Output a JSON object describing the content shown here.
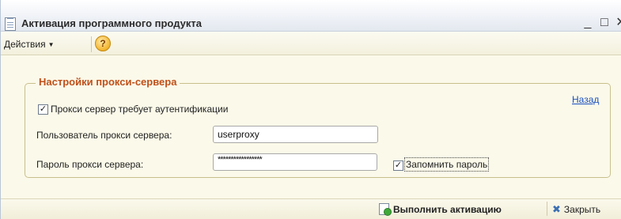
{
  "window": {
    "title": "Активация программного продукта",
    "minimize_glyph": "_",
    "maximize_glyph": "□",
    "close_glyph": "✕"
  },
  "toolbar": {
    "actions_label": "Действия",
    "help_glyph": "?"
  },
  "proxy": {
    "group_title": "Настройки прокси-сервера",
    "auth_checkbox_label": "Прокси сервер требует аутентификации",
    "auth_checked": true,
    "back_link": "Назад",
    "user_label": "Пользователь прокси сервера:",
    "user_value": "userproxy",
    "password_label": "Пароль прокси сервера:",
    "password_value": "*****************",
    "remember_label": "Запомнить пароль",
    "remember_checked": true
  },
  "footer": {
    "activate_label": "Выполнить активацию",
    "close_label": "Закрыть"
  },
  "colors": {
    "group_title": "#c0501a",
    "link": "#1a4fc2",
    "panel_bg": "#fbf9e9"
  }
}
